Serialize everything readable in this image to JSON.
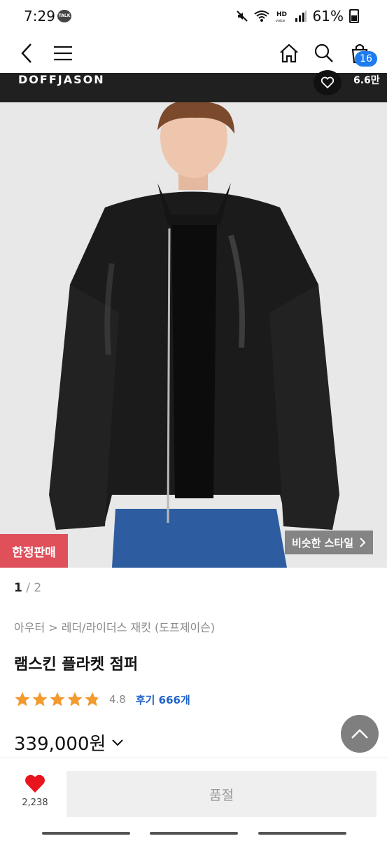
{
  "status_bar": {
    "time": "7:29",
    "talk_badge": "TALK",
    "battery": "61%"
  },
  "top_nav": {
    "cart_count": "16"
  },
  "brand_bar": {
    "brand": "DOFFJASON",
    "likes": "6.6만"
  },
  "hero": {
    "limited_label": "한정판매",
    "similar_style_label": "비슷한 스타일"
  },
  "product": {
    "pager_current": "1",
    "pager_rest": " / 2",
    "breadcrumb": "아우터 > 레더/라이더스 재킷 (도프제이슨)",
    "title": "램스킨 플라켓 점퍼",
    "rating": 4.8,
    "rating_label": "4.8",
    "reviews": "후기 666개",
    "price": "339,000원"
  },
  "bottom_bar": {
    "wish_count": "2,238",
    "soldout_label": "품절"
  },
  "colors": {
    "accent_blue": "#1e7bf0",
    "limited_red": "#e0505b",
    "star_orange": "#f29a2e"
  }
}
